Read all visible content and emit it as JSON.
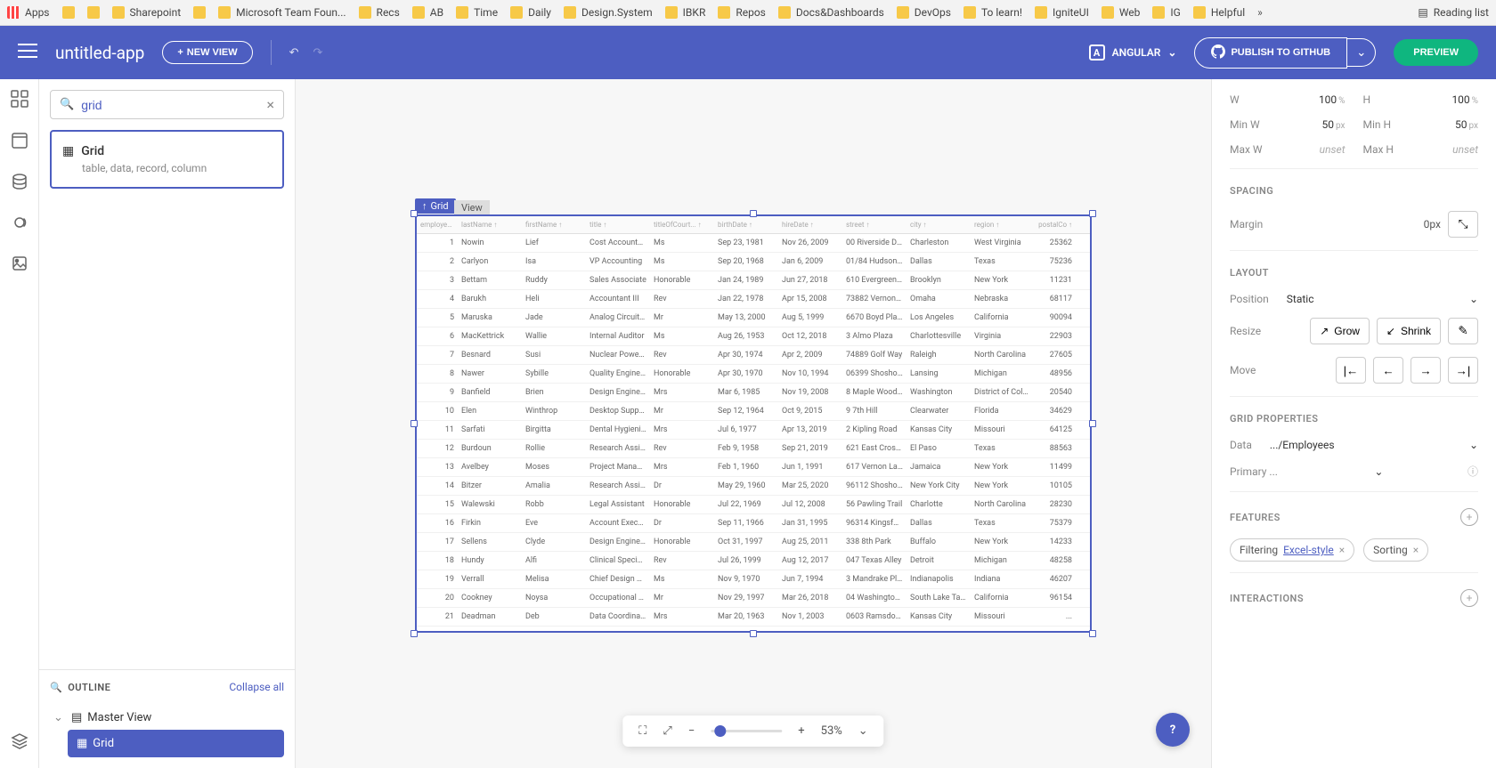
{
  "browser_bookmarks": [
    "Apps",
    "",
    "",
    "Sharepoint",
    "",
    "Microsoft Team Foun...",
    "Recs",
    "AB",
    "Time",
    "Daily",
    "Design.System",
    "IBKR",
    "Repos",
    "Docs&Dashboards",
    "DevOps",
    "To learn!",
    "IgniteUI",
    "Web",
    "IG",
    "Helpful"
  ],
  "browser_right": "Reading list",
  "header": {
    "app_title": "untitled-app",
    "new_view": "NEW VIEW",
    "framework": "ANGULAR",
    "publish": "PUBLISH TO GITHUB",
    "preview": "PREVIEW"
  },
  "search": {
    "value": "grid"
  },
  "component": {
    "title": "Grid",
    "subtitle": "table, data, record, column"
  },
  "outline": {
    "title": "OUTLINE",
    "collapse": "Collapse all",
    "master": "Master View",
    "grid": "Grid"
  },
  "canvas": {
    "badge": "Grid",
    "view_badge": "View",
    "zoom": "53%"
  },
  "grid": {
    "headers": [
      "employeeID",
      "lastName",
      "firstName",
      "title",
      "titleOfCourt...",
      "birthDate",
      "hireDate",
      "street",
      "city",
      "region",
      "postalCo"
    ],
    "rows": [
      [
        "1",
        "Nowin",
        "Lief",
        "Cost Accountant",
        "Ms",
        "Sep 23, 1981",
        "Nov 26, 2009",
        "00 Riverside Drive",
        "Charleston",
        "West Virginia",
        "25362"
      ],
      [
        "2",
        "Carlyon",
        "Isa",
        "VP Accounting",
        "Ms",
        "Sep 20, 1968",
        "Jan 6, 2009",
        "01/84 Hudson T...",
        "Dallas",
        "Texas",
        "75236"
      ],
      [
        "3",
        "Bettam",
        "Ruddy",
        "Sales Associate",
        "Honorable",
        "Jan 24, 1989",
        "Jun 27, 2018",
        "610 Evergreen T...",
        "Brooklyn",
        "New York",
        "11231"
      ],
      [
        "4",
        "Barukh",
        "Heli",
        "Accountant III",
        "Rev",
        "Jan 22, 1978",
        "Apr 15, 2008",
        "73882 Vernon Cr...",
        "Omaha",
        "Nebraska",
        "68117"
      ],
      [
        "5",
        "Maruska",
        "Jade",
        "Analog Circuit De...",
        "Mr",
        "May 13, 2000",
        "Aug 5, 1999",
        "6670 Boyd Place",
        "Los Angeles",
        "California",
        "90094"
      ],
      [
        "6",
        "MacKettrick",
        "Wallie",
        "Internal Auditor",
        "Ms",
        "Aug 26, 1953",
        "Oct 12, 2018",
        "3 Almo Plaza",
        "Charlottesville",
        "Virginia",
        "22903"
      ],
      [
        "7",
        "Besnard",
        "Susi",
        "Nuclear Power E...",
        "Rev",
        "Apr 30, 1974",
        "Apr 2, 2009",
        "74889 Golf Way",
        "Raleigh",
        "North Carolina",
        "27605"
      ],
      [
        "8",
        "Nawer",
        "Sybille",
        "Quality Engineer",
        "Honorable",
        "Apr 30, 1970",
        "Nov 10, 1994",
        "06399 Shoshone...",
        "Lansing",
        "Michigan",
        "48956"
      ],
      [
        "9",
        "Banfield",
        "Brien",
        "Design Engineer",
        "Mrs",
        "Mar 6, 1985",
        "Nov 19, 2008",
        "8 Maple Wood P...",
        "Washington",
        "District of Colum...",
        "20540"
      ],
      [
        "10",
        "Elen",
        "Winthrop",
        "Desktop Support...",
        "Mr",
        "Sep 12, 1964",
        "Oct 9, 2015",
        "9 7th Hill",
        "Clearwater",
        "Florida",
        "34629"
      ],
      [
        "11",
        "Sarfati",
        "Birgitta",
        "Dental Hygienist",
        "Mrs",
        "Jul 6, 1977",
        "Apr 13, 2019",
        "2 Kipling Road",
        "Kansas City",
        "Missouri",
        "64125"
      ],
      [
        "12",
        "Burdoun",
        "Rollie",
        "Research Assista...",
        "Rev",
        "Feb 9, 1958",
        "Sep 21, 2019",
        "621 East Crossing",
        "El Paso",
        "Texas",
        "88563"
      ],
      [
        "13",
        "Avelbey",
        "Moses",
        "Project Manager",
        "Mrs",
        "Feb 1, 1960",
        "Jun 1, 1991",
        "617 Vernon Lane",
        "Jamaica",
        "New York",
        "11499"
      ],
      [
        "14",
        "Bitzer",
        "Amalia",
        "Research Assista...",
        "Dr",
        "May 29, 1960",
        "Mar 25, 2020",
        "96112 Shoshone...",
        "New York City",
        "New York",
        "10105"
      ],
      [
        "15",
        "Walewski",
        "Robb",
        "Legal Assistant",
        "Honorable",
        "Jul 22, 1969",
        "Jul 12, 2008",
        "56 Pawling Trail",
        "Charlotte",
        "North Carolina",
        "28230"
      ],
      [
        "16",
        "Firkin",
        "Eve",
        "Account Executive",
        "Dr",
        "Sep 11, 1966",
        "Jan 31, 1995",
        "96314 Kingsford...",
        "Dallas",
        "Texas",
        "75379"
      ],
      [
        "17",
        "Sellens",
        "Clyde",
        "Design Engineer",
        "Honorable",
        "Oct 31, 1997",
        "Aug 25, 2011",
        "338 8th Park",
        "Buffalo",
        "New York",
        "14233"
      ],
      [
        "18",
        "Hundy",
        "Alfi",
        "Clinical Specialist",
        "Rev",
        "Jul 26, 1999",
        "Aug 12, 2017",
        "047 Texas Alley",
        "Detroit",
        "Michigan",
        "48258"
      ],
      [
        "19",
        "Verrall",
        "Melisa",
        "Chief Design Eng...",
        "Ms",
        "Nov 9, 1970",
        "Jun 7, 1994",
        "3 Mandrake Plaza",
        "Indianapolis",
        "Indiana",
        "46207"
      ],
      [
        "20",
        "Cookney",
        "Noysa",
        "Occupational The...",
        "Mr",
        "Nov 29, 1997",
        "Mar 26, 2018",
        "04 Washington C...",
        "South Lake Tahoe",
        "California",
        "96154"
      ],
      [
        "21",
        "Deadman",
        "Deb",
        "Data Coordinator",
        "Mrs",
        "Mar 20, 1963",
        "Nov 1, 2003",
        "0603 Ramsdown",
        "Kansas City",
        "Missouri",
        "..."
      ]
    ]
  },
  "props": {
    "w": {
      "v": "100",
      "u": "%"
    },
    "h": {
      "v": "100",
      "u": "%"
    },
    "minw": {
      "v": "50",
      "u": "px"
    },
    "minh": {
      "v": "50",
      "u": "px"
    },
    "maxw": "unset",
    "maxh": "unset",
    "spacing_title": "SPACING",
    "margin_label": "Margin",
    "margin": {
      "v": "0",
      "u": "px"
    },
    "layout_title": "LAYOUT",
    "position_label": "Position",
    "position": "Static",
    "resize_label": "Resize",
    "grow": "Grow",
    "shrink": "Shrink",
    "move_label": "Move",
    "grid_title": "GRID PROPERTIES",
    "data_label": "Data",
    "data_value": ".../Employees",
    "primary_label": "Primary ...",
    "features_title": "FEATURES",
    "filtering": "Filtering",
    "excel": "Excel-style",
    "sorting": "Sorting",
    "interactions_title": "INTERACTIONS"
  }
}
